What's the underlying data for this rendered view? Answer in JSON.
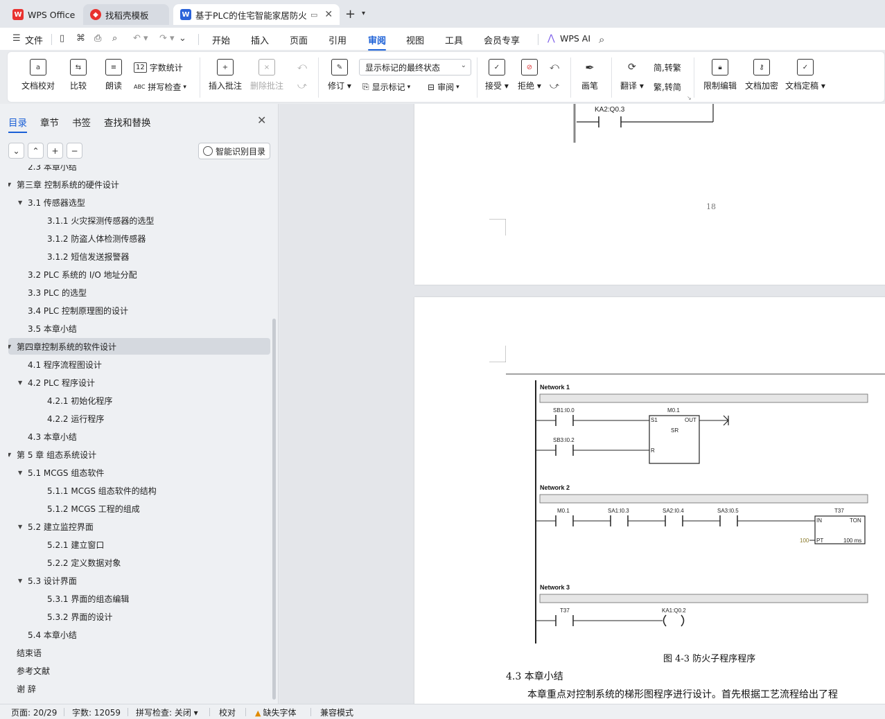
{
  "tabs": [
    {
      "label": "WPS Office",
      "icon": "wps-logo-icon"
    },
    {
      "label": "找稻壳模板",
      "icon": "daoke-icon"
    },
    {
      "label": "基于PLC的住宅智能家居防火防",
      "icon": "wps-writer-icon"
    }
  ],
  "menu": {
    "file": "文件",
    "items": [
      "开始",
      "插入",
      "页面",
      "引用",
      "审阅",
      "视图",
      "工具",
      "会员专享"
    ],
    "active": "审阅",
    "wps_ai": "WPS AI"
  },
  "ribbon": {
    "doc_proof": "文档校对",
    "compare": "比较",
    "read_aloud": "朗读",
    "word_count": "字数统计",
    "spell_check": "拼写检查",
    "insert_comment": "插入批注",
    "delete_comment": "删除批注",
    "revise": "修订",
    "markup_state": "显示标记的最终状态",
    "show_markup": "显示标记",
    "review": "审阅",
    "accept": "接受",
    "reject": "拒绝",
    "ink": "画笔",
    "translate": "翻译",
    "to_traditional": "简,转繁",
    "to_simplified": "繁,转简",
    "restrict_edit": "限制编辑",
    "encrypt": "文档加密",
    "finalize": "文档定稿"
  },
  "nav": {
    "tabs": [
      "目录",
      "章节",
      "书签",
      "查找和替换"
    ],
    "smart_toc": "智能识别目录",
    "toc": [
      {
        "text": "2.3   本章小结",
        "level": 2,
        "arrow": ""
      },
      {
        "text": "第三章   控制系统的硬件设计",
        "level": 1,
        "arrow": "▼"
      },
      {
        "text": "3.1    传感器选型",
        "level": 2,
        "arrow": "▼"
      },
      {
        "text": "3.1.1    火灾探测传感器的选型",
        "level": 3,
        "arrow": ""
      },
      {
        "text": "3.1.2    防盗人体检测传感器",
        "level": 3,
        "arrow": ""
      },
      {
        "text": "3.1.2    短信发送报警器",
        "level": 3,
        "arrow": ""
      },
      {
        "text": "3.2    PLC 系统的 I/O 地址分配",
        "level": 2,
        "arrow": ""
      },
      {
        "text": "3.3    PLC 的选型",
        "level": 2,
        "arrow": ""
      },
      {
        "text": "3.4    PLC 控制原理图的设计",
        "level": 2,
        "arrow": ""
      },
      {
        "text": "3.5    本章小结",
        "level": 2,
        "arrow": ""
      },
      {
        "text": "第四章控制系统的软件设计",
        "level": 1,
        "arrow": "▼",
        "selected": true
      },
      {
        "text": "4.1  程序流程图设计",
        "level": 2,
        "arrow": ""
      },
      {
        "text": "4.2 PLC 程序设计",
        "level": 2,
        "arrow": "▼"
      },
      {
        "text": "4.2.1  初始化程序",
        "level": 3,
        "arrow": ""
      },
      {
        "text": "4.2.2  运行程序",
        "level": 3,
        "arrow": ""
      },
      {
        "text": "4.3    本章小结",
        "level": 2,
        "arrow": ""
      },
      {
        "text": "第 5 章    组态系统设计",
        "level": 1,
        "arrow": "▼"
      },
      {
        "text": "5.1    MCGS 组态软件",
        "level": 2,
        "arrow": "▼"
      },
      {
        "text": "5.1.1 MCGS 组态软件的结构",
        "level": 3,
        "arrow": ""
      },
      {
        "text": "5.1.2 MCGS 工程的组成",
        "level": 3,
        "arrow": ""
      },
      {
        "text": "5.2    建立监控界面",
        "level": 2,
        "arrow": "▼"
      },
      {
        "text": "5.2.1    建立窗口",
        "level": 3,
        "arrow": ""
      },
      {
        "text": "5.2.2    定义数据对象",
        "level": 3,
        "arrow": ""
      },
      {
        "text": "5.3    设计界面",
        "level": 2,
        "arrow": "▼"
      },
      {
        "text": "5.3.1    界面的组态编辑",
        "level": 3,
        "arrow": ""
      },
      {
        "text": "5.3.2  界面的设计",
        "level": 3,
        "arrow": ""
      },
      {
        "text": "5.4    本章小结",
        "level": 2,
        "arrow": ""
      },
      {
        "text": "结束语",
        "level": 1,
        "arrow": ""
      },
      {
        "text": "参考文献",
        "level": 1,
        "arrow": ""
      },
      {
        "text": "谢    辞",
        "level": 1,
        "arrow": ""
      }
    ]
  },
  "doc": {
    "page_number": "18",
    "ladder_top_label": "KA2:Q0.3",
    "networks": [
      "Network 1",
      "Network 2",
      "Network 3"
    ],
    "n1": {
      "c1": "SB1:I0.0",
      "c2": "SB3:I0.2",
      "box": "M0.1",
      "s1": "S1",
      "out": "OUT",
      "sr": "SR",
      "r": "R"
    },
    "n2": {
      "c1": "M0.1",
      "c2": "SA1:I0.3",
      "c3": "SA2:I0.4",
      "c4": "SA3:I0.5",
      "timer": "T37",
      "in": "IN",
      "ton": "TON",
      "pt_val": "100",
      "pt": "PT",
      "ms": "100 ms"
    },
    "n3": {
      "c1": "T37",
      "coil": "KA1:Q0.2"
    },
    "caption": "图 4-3 防火子程序程序",
    "heading": "4.3   本章小结",
    "paragraph": "本章重点对控制系统的梯形图程序进行设计。首先根据工艺流程给出了程"
  },
  "status": {
    "page": "页面: 20/29",
    "words": "字数: 12059",
    "spell": "拼写检查: 关闭",
    "proof": "校对",
    "missing_font": "缺失字体",
    "compat": "兼容模式"
  },
  "colors": {
    "accent": "#1a5fd6",
    "wps_red": "#e8322f",
    "writer_blue": "#2b63d9"
  }
}
